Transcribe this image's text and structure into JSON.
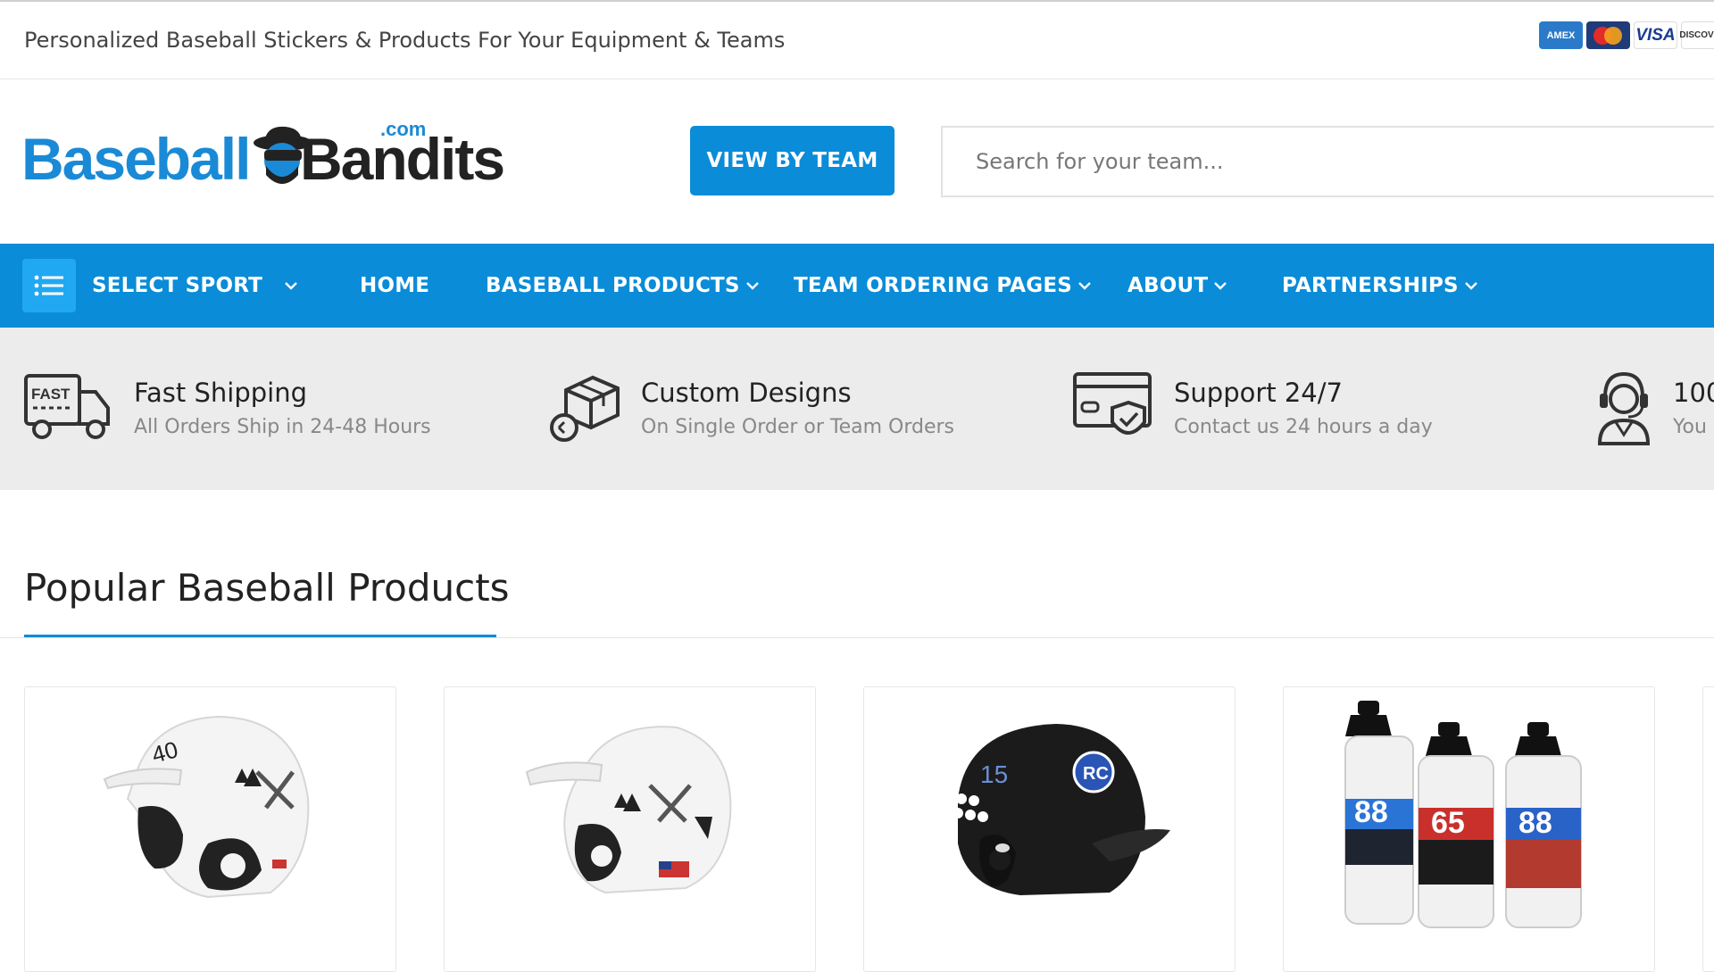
{
  "topbar": {
    "tagline": "Personalized Baseball Stickers & Products For Your Equipment & Teams",
    "payment_cards": [
      {
        "name": "american-express",
        "label": "AMERICAN EXPRESS"
      },
      {
        "name": "mastercard",
        "label": "MasterCard"
      },
      {
        "name": "visa",
        "label": "VISA"
      },
      {
        "name": "discover",
        "label": "DISCOVER"
      }
    ]
  },
  "header": {
    "logo": {
      "left": "Baseball",
      "right": "Bandits",
      "suffix": ".com"
    },
    "view_by_team_label": "VIEW BY TEAM",
    "search_placeholder": "Search for your team..."
  },
  "nav": {
    "select_sport_label": "SELECT SPORT",
    "items": [
      {
        "label": "HOME",
        "has_dropdown": false
      },
      {
        "label": "BASEBALL PRODUCTS",
        "has_dropdown": true
      },
      {
        "label": "TEAM ORDERING PAGES",
        "has_dropdown": true
      },
      {
        "label": "ABOUT",
        "has_dropdown": true
      },
      {
        "label": "PARTNERSHIPS",
        "has_dropdown": true
      }
    ]
  },
  "features": [
    {
      "icon": "fast-truck-icon",
      "title": "Fast Shipping",
      "subtitle": "All Orders Ship in 24-48 Hours"
    },
    {
      "icon": "custom-box-icon",
      "title": "Custom Designs",
      "subtitle": "On Single Order or Team Orders"
    },
    {
      "icon": "secure-card-icon",
      "title": "Support 24/7",
      "subtitle": "Contact us 24 hours a day"
    },
    {
      "icon": "headset-agent-icon",
      "title": "100",
      "subtitle": "You"
    }
  ],
  "section": {
    "title": "Popular Baseball Products"
  },
  "products": [
    {
      "name": "white-batting-helmet-number-40",
      "number": "40"
    },
    {
      "name": "white-batting-helmet-flag"
    },
    {
      "name": "black-batting-helmet-number-15",
      "number": "15",
      "logo": "RC"
    },
    {
      "name": "water-bottles-set",
      "numbers": [
        "88",
        "65",
        "88"
      ]
    }
  ],
  "colors": {
    "brand_blue": "#0a8cd8",
    "nav_icon_blue": "#21a8f2",
    "feature_strip": "#ececec"
  }
}
